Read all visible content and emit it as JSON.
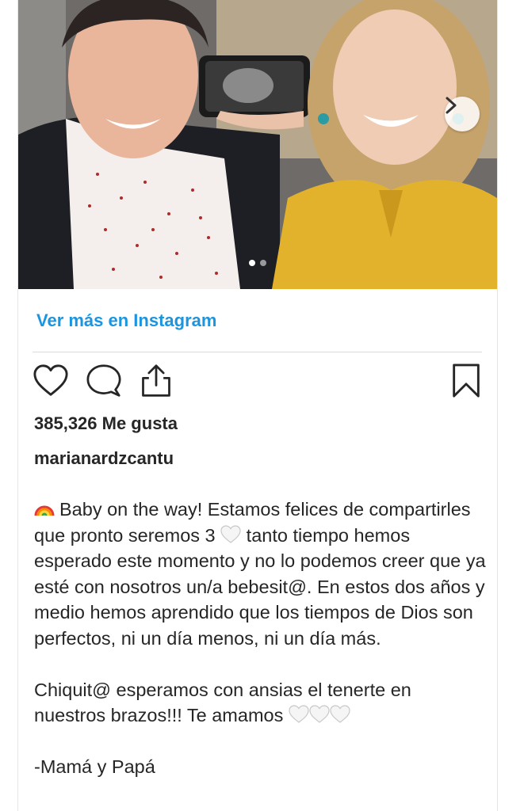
{
  "post": {
    "more_link": "Ver más en Instagram",
    "likes": "385,326 Me gusta",
    "username": "marianardzcantu",
    "caption": {
      "line1": "Baby on the way! Estamos felices de compartirles que pronto seremos 3",
      "line1b": "tanto tiempo hemos esperado este momento y no lo podemos creer que ya esté con nosotros un/a bebesit@. En estos dos años y medio hemos aprendido que los tiempos de Dios son perfectos, ni un día menos, ni un día más.",
      "line2": "Chiquit@ esperamos con ansias el tenerte en nuestros brazos!!! Te amamos",
      "line3": "-Mamá y Papá"
    }
  },
  "carousel": {
    "current": 1,
    "total": 2
  },
  "icons": {
    "like": "heart-icon",
    "comment": "comment-bubble-icon",
    "share": "share-icon",
    "save": "bookmark-icon",
    "next": "chevron-right-icon"
  },
  "colors": {
    "link": "#1b95e0",
    "text": "#262626",
    "divider": "#dbdbdb"
  }
}
